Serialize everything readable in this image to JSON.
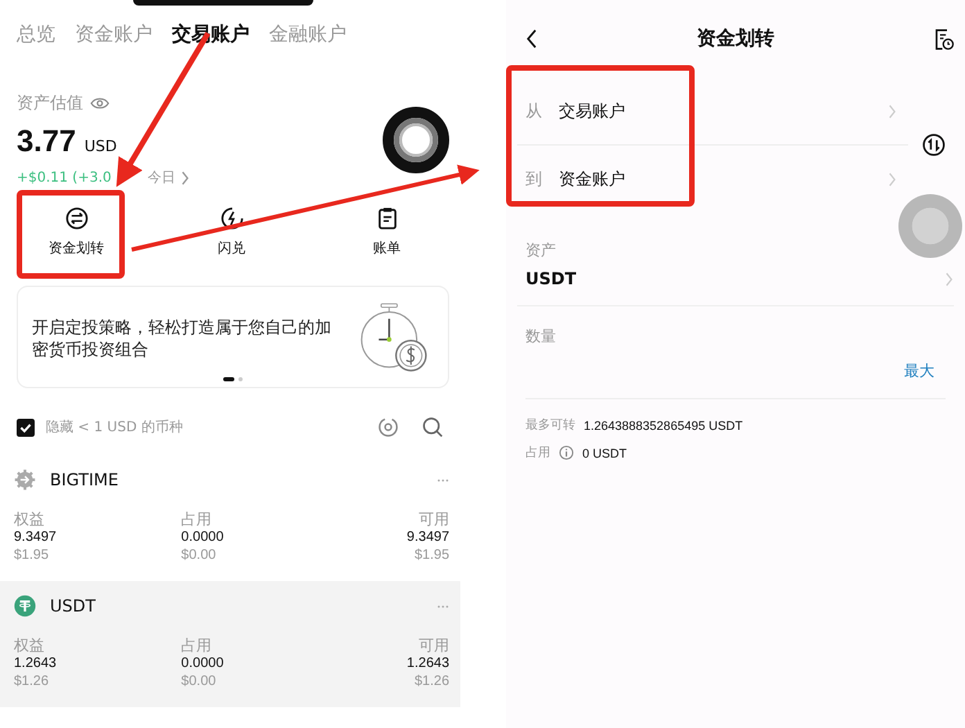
{
  "left": {
    "tabs": [
      {
        "label": "总览",
        "selected": false
      },
      {
        "label": "资金账户",
        "selected": false
      },
      {
        "label": "交易账户",
        "selected": true
      },
      {
        "label": "金融账户",
        "selected": false
      }
    ],
    "valuation": {
      "label": "资产估值",
      "amount": "3.77",
      "currency": "USD",
      "change": "+$0.11 (+3.0",
      "period": "今日"
    },
    "actions": [
      {
        "kind": "transfer",
        "label": "资金划转"
      },
      {
        "kind": "flash",
        "label": "闪兑"
      },
      {
        "kind": "bill",
        "label": "账单"
      }
    ],
    "banner": {
      "text": "开启定投策略，轻松打造属于您自己的加密货币投资组合",
      "pages": [
        {
          "selected": true
        },
        {
          "selected": false
        }
      ]
    },
    "filter": {
      "label": "隐藏 < 1 USD 的币种",
      "checked": true
    },
    "assets": [
      {
        "kind": "bigtime",
        "name": "BIGTIME",
        "columns": [
          {
            "label": "权益",
            "value": "9.3497",
            "usd": "$1.95"
          },
          {
            "label": "占用",
            "value": "0.0000",
            "usd": "$0.00"
          },
          {
            "label": "可用",
            "value": "9.3497",
            "usd": "$1.95"
          }
        ]
      },
      {
        "kind": "usdt",
        "name": "USDT",
        "columns": [
          {
            "label": "权益",
            "value": "1.2643",
            "usd": "$1.26"
          },
          {
            "label": "占用",
            "value": "0.0000",
            "usd": "$0.00"
          },
          {
            "label": "可用",
            "value": "1.2643",
            "usd": "$1.26"
          }
        ]
      }
    ]
  },
  "right": {
    "title": "资金划转",
    "from": {
      "label": "从",
      "value": "交易账户"
    },
    "to": {
      "label": "到",
      "value": "资金账户"
    },
    "asset": {
      "label": "资产",
      "value": "USDT"
    },
    "amount": {
      "label": "数量",
      "max": "最大"
    },
    "max_transfer": {
      "label": "最多可转",
      "value": "1.2643888352865495 USDT"
    },
    "occupied": {
      "label": "占用",
      "value": "0 USDT"
    }
  }
}
